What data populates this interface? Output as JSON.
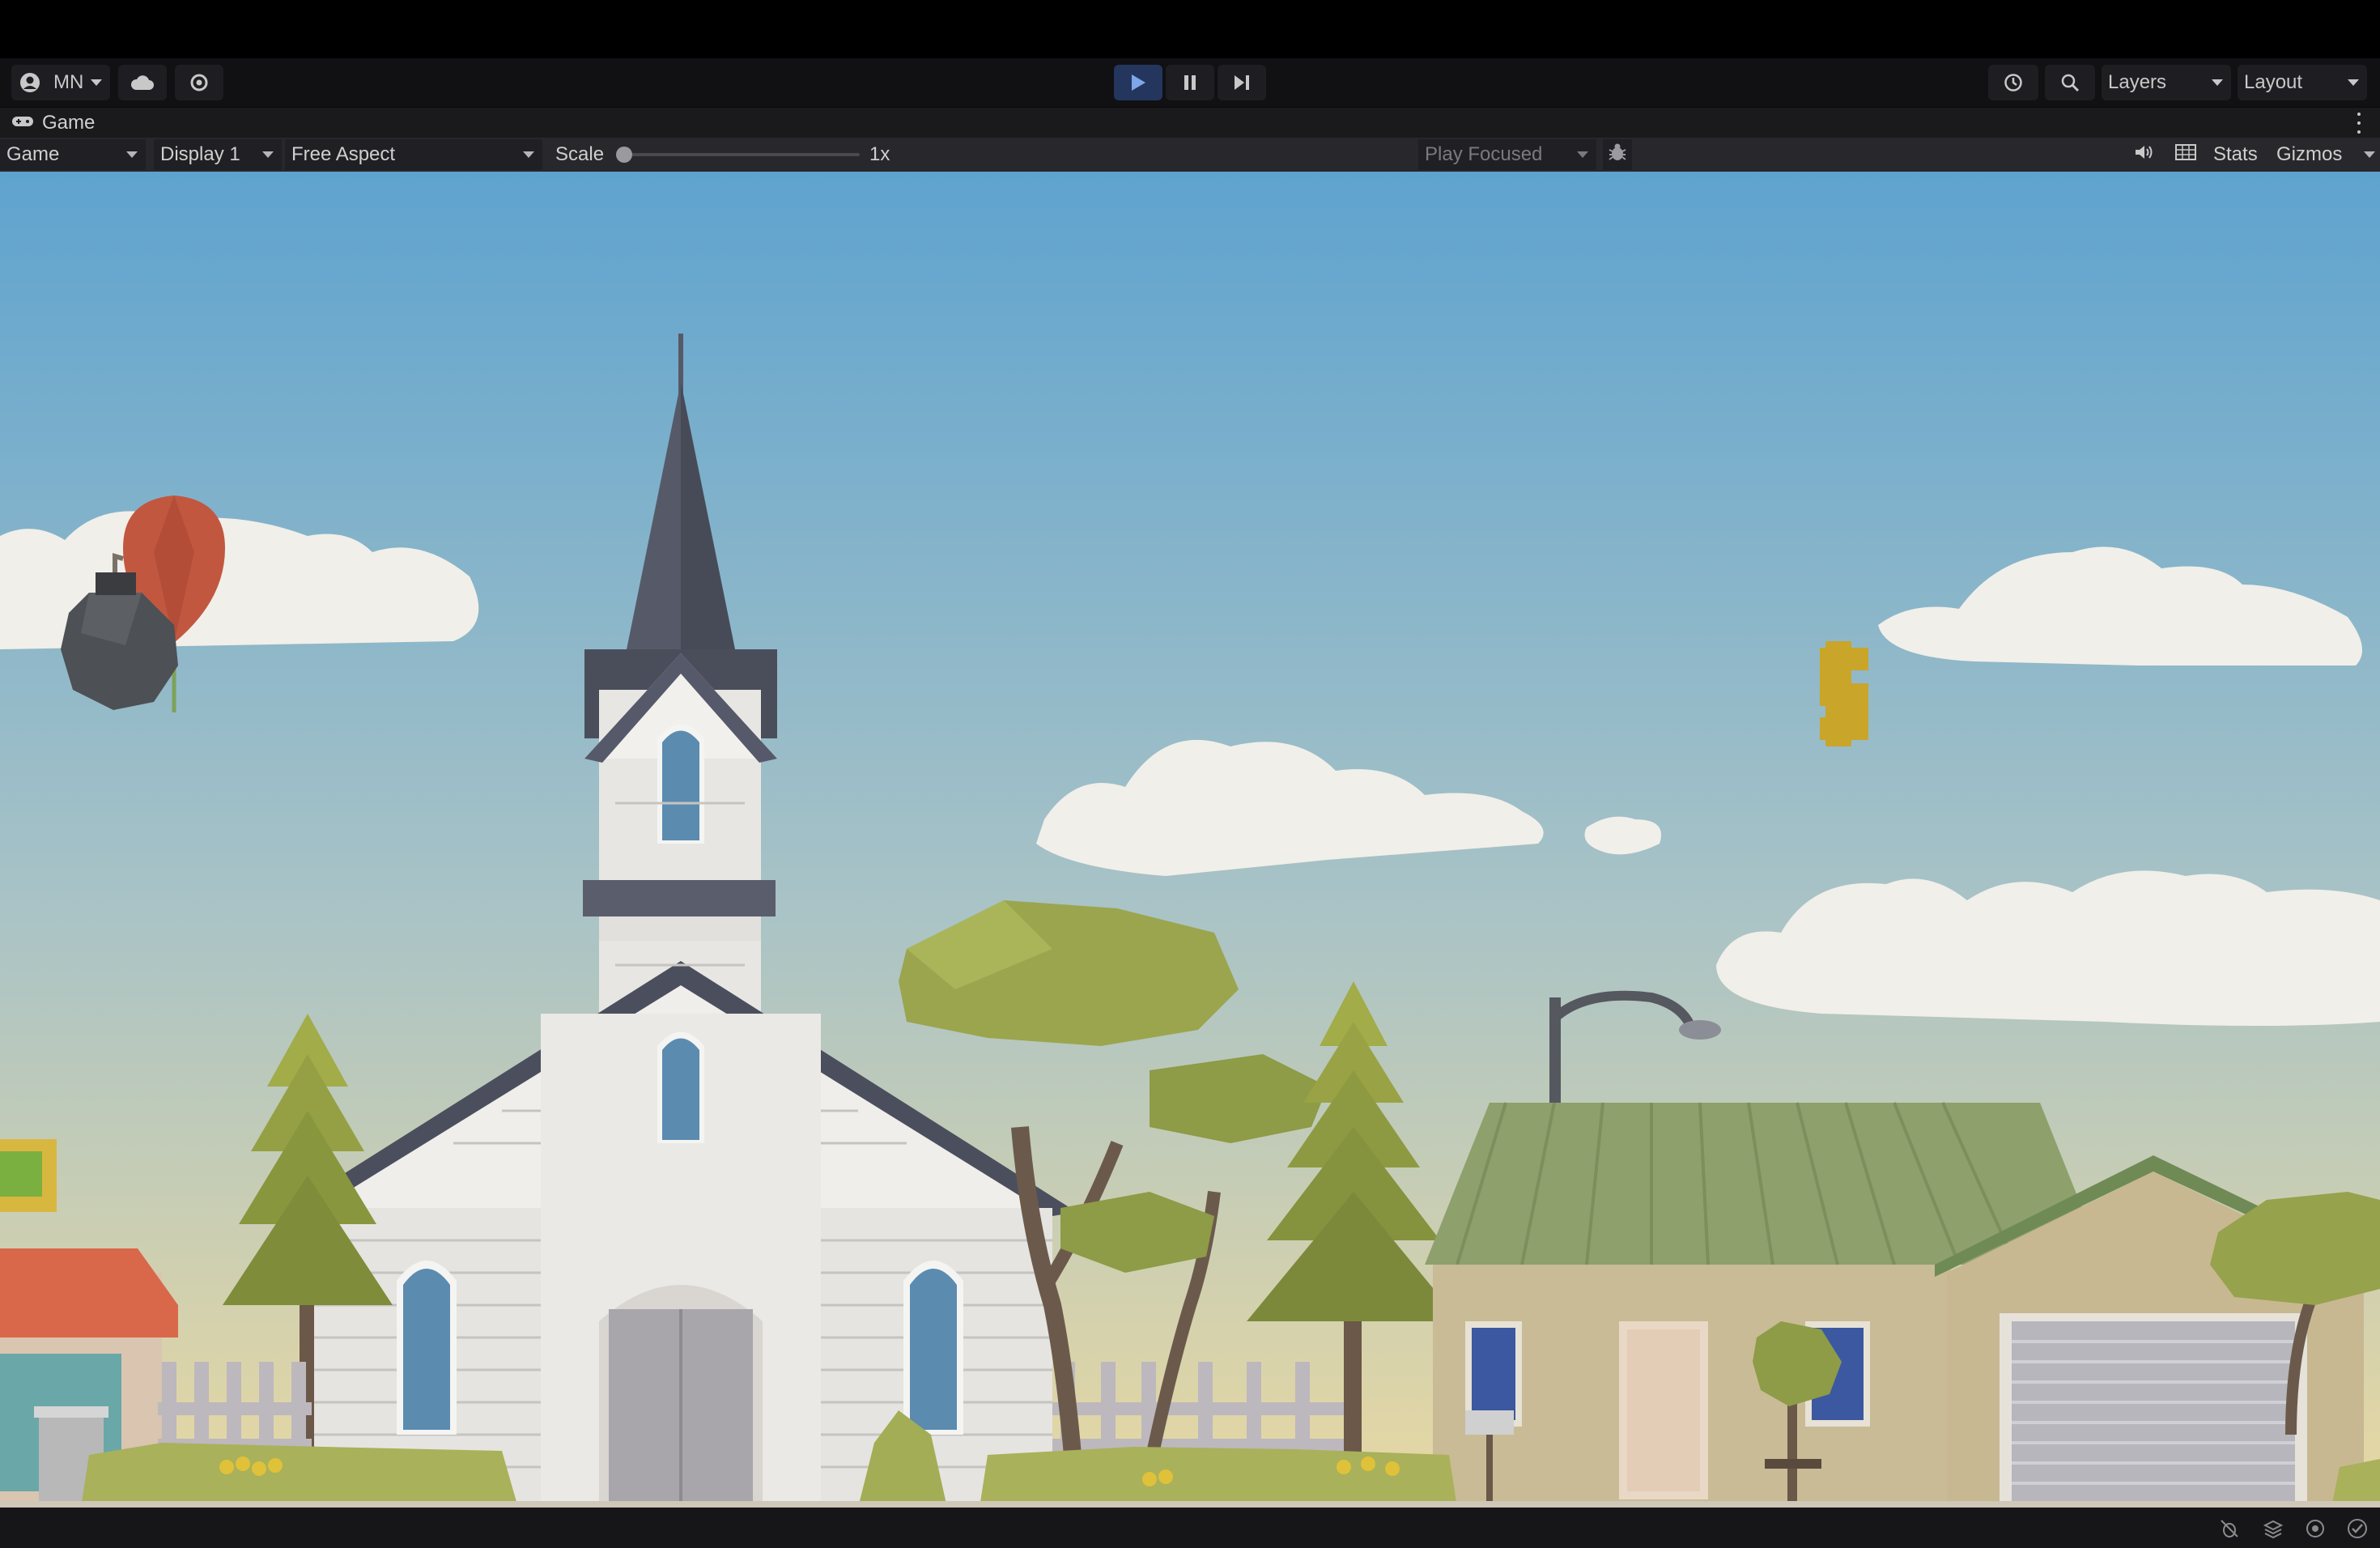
{
  "toolbar": {
    "account_label": "MN",
    "layers_label": "Layers",
    "layout_label": "Layout",
    "icons": {
      "account": "account-icon",
      "cloud": "cloud-icon",
      "settings": "gear-icon",
      "play": "play-icon",
      "pause": "pause-icon",
      "step": "step-icon",
      "history": "history-icon",
      "search": "search-icon"
    },
    "accent_color": "#3c5fa8"
  },
  "tab": {
    "label": "Game",
    "icon": "gamepad-icon"
  },
  "game_toolbar": {
    "view_mode": "Game",
    "display": "Display 1",
    "aspect": "Free Aspect",
    "scale_label": "Scale",
    "scale_value": "1x",
    "scale_fraction": 0,
    "play_mode": "Play Focused",
    "stats_label": "Stats",
    "gizmos_label": "Gizmos",
    "icons": {
      "bug": "bug-icon",
      "audio": "speaker-icon",
      "grid": "grid-icon"
    }
  },
  "scene": {
    "sky_top": "#5ea3cf",
    "sky_bottom": "#e3d6a4",
    "objects": [
      "balloon",
      "bomb",
      "dollar-sign",
      "church",
      "trees",
      "street-lamp",
      "house",
      "garage",
      "fence",
      "bushes",
      "shop"
    ],
    "balloon_color": "#c2573f",
    "bomb_color": "#4d5055",
    "dollar_color": "#c9a52a"
  },
  "statusbar": {
    "icons": [
      "bug-status-icon",
      "layers-status-icon",
      "render-status-icon",
      "check-status-icon"
    ]
  }
}
